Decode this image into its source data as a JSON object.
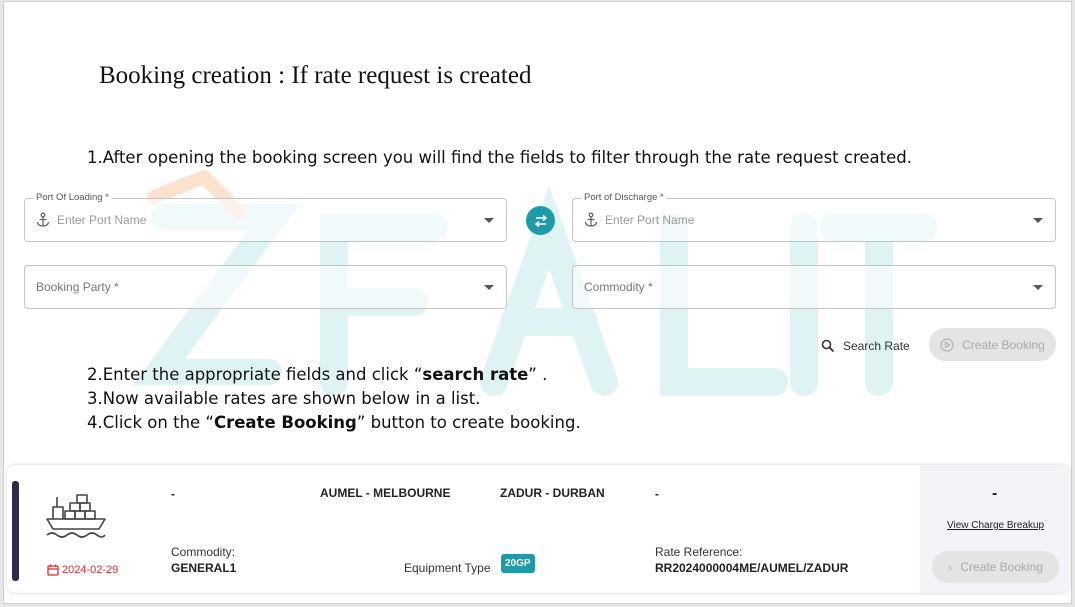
{
  "title": "Booking creation : If rate request is created",
  "steps": {
    "step1": "1.After opening the booking screen you will find the fields to filter through the rate request created.",
    "step2_pre": "2.Enter the appropriate fields and click “",
    "step2_bold": "search rate",
    "step2_post": "” .",
    "step3": "3.Now available rates are shown below in a list.",
    "step4_pre": "4.Click on the “",
    "step4_bold": "Create Booking",
    "step4_post": "” button to create booking."
  },
  "form": {
    "port_loading": {
      "label": "Port Of Loading *",
      "placeholder": "Enter Port Name"
    },
    "port_discharge": {
      "label": "Port of Discharge *",
      "placeholder": "Enter Port Name"
    },
    "booking_party": {
      "placeholder": "Booking Party *"
    },
    "commodity": {
      "placeholder": "Commodity *"
    },
    "search_rate_label": "Search Rate",
    "create_booking_label": "Create Booking"
  },
  "watermark": {
    "text": "FALIT"
  },
  "rate_card": {
    "col1_value": "-",
    "origin": "AUMEL - MELBOURNE",
    "destination": "ZADUR - DURBAN",
    "col4_value": "-",
    "price": "-",
    "view_charge_label": "View Charge Breakup",
    "commodity_label": "Commodity:",
    "commodity_value": "GENERAL1",
    "equipment_label": "Equipment Type",
    "equipment_value": "20GP",
    "rate_ref_label": "Rate Reference:",
    "rate_ref_value": "RR2024000004ME/AUMEL/ZADUR",
    "date": "2024-02-29",
    "create_booking_label": "Create Booking"
  },
  "colors": {
    "accent": "#1e9aa8",
    "date": "#d32f2f",
    "bar": "#2a2a4a"
  }
}
